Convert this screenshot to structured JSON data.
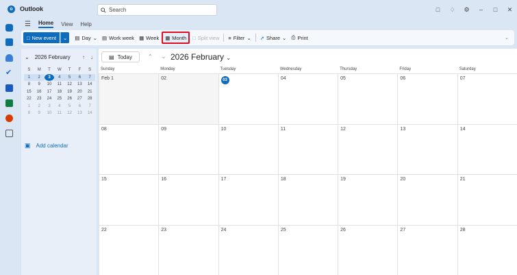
{
  "app": {
    "title": "Outlook",
    "logo_letter": "o"
  },
  "search": {
    "placeholder": "Search"
  },
  "ribbon": {
    "tabs": [
      "Home",
      "View",
      "Help"
    ],
    "active_tab": "Home"
  },
  "toolbar": {
    "new_event": "New event",
    "day": "Day",
    "work_week": "Work week",
    "week": "Week",
    "month": "Month",
    "split_view": "Split view",
    "filter": "Filter",
    "share": "Share",
    "print": "Print"
  },
  "mini_calendar": {
    "title": "2026 February",
    "weekdays": [
      "S",
      "M",
      "T",
      "W",
      "T",
      "F",
      "S"
    ],
    "days": [
      [
        "1",
        "2",
        "3",
        "4",
        "5",
        "6",
        "7"
      ],
      [
        "8",
        "9",
        "10",
        "11",
        "12",
        "13",
        "14"
      ],
      [
        "15",
        "16",
        "17",
        "18",
        "19",
        "20",
        "21"
      ],
      [
        "22",
        "23",
        "24",
        "25",
        "26",
        "27",
        "28"
      ],
      [
        "1",
        "2",
        "3",
        "4",
        "5",
        "6",
        "7"
      ],
      [
        "8",
        "9",
        "10",
        "11",
        "12",
        "13",
        "14"
      ]
    ],
    "today": "3"
  },
  "add_calendar": "Add calendar",
  "calendar": {
    "today_label": "Today",
    "period": "2026 February",
    "day_headers": [
      "Sunday",
      "Monday",
      "Tuesday",
      "Wednesday",
      "Thursday",
      "Friday",
      "Saturday"
    ],
    "weeks": [
      [
        "Feb 1",
        "02",
        "03",
        "04",
        "05",
        "06",
        "07"
      ],
      [
        "08",
        "09",
        "10",
        "11",
        "12",
        "13",
        "14"
      ],
      [
        "15",
        "16",
        "17",
        "18",
        "19",
        "20",
        "21"
      ],
      [
        "22",
        "23",
        "24",
        "25",
        "26",
        "27",
        "28"
      ]
    ],
    "today": "03"
  },
  "colors": {
    "accent": "#0f6cbd",
    "highlight_border": "#e00b1c",
    "background": "#dbe6f4"
  }
}
